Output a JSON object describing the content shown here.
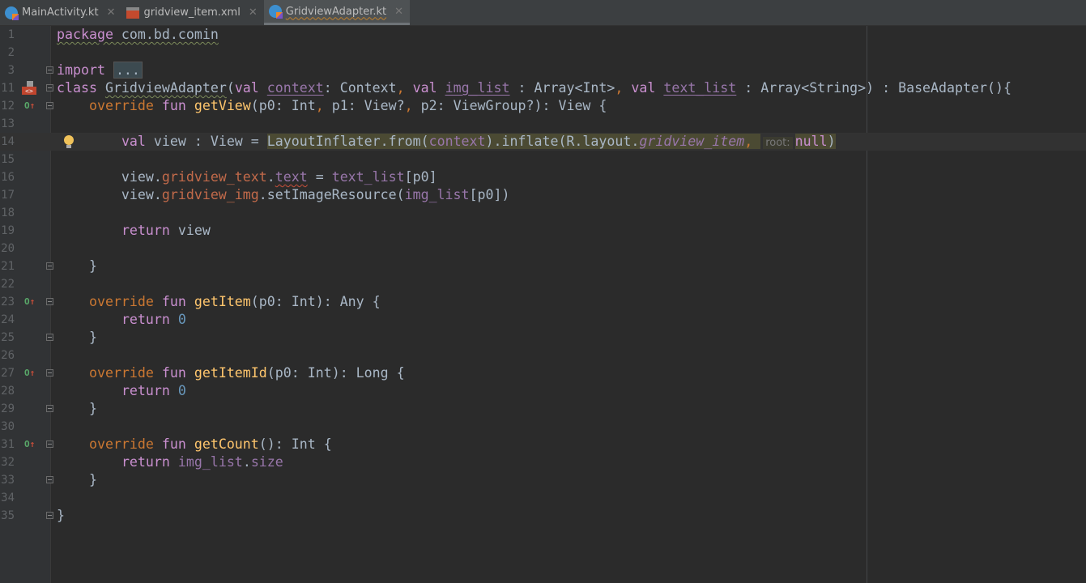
{
  "tabs": [
    {
      "label": "MainActivity.kt",
      "icon": "kotlin-file-icon",
      "active": false
    },
    {
      "label": "gridview_item.xml",
      "icon": "xml-layout-icon",
      "active": false
    },
    {
      "label": "GridviewAdapter.kt",
      "icon": "kotlin-file-icon",
      "active": true
    }
  ],
  "close_glyph": "✕",
  "lines": [
    {
      "num": "1",
      "t": [
        [
          "k wv",
          "package"
        ],
        [
          "t wv",
          " com.bd.comin"
        ]
      ]
    },
    {
      "num": "2",
      "t": []
    },
    {
      "num": "3",
      "fold": true,
      "t": [
        [
          "k",
          "import "
        ],
        [
          "fc o",
          "..."
        ]
      ]
    },
    {
      "num": "11",
      "fold": true,
      "gutter": "xml",
      "t": [
        [
          "k",
          "class "
        ],
        [
          "t wv",
          "GridviewAdapter"
        ],
        [
          "t",
          "("
        ],
        [
          "k",
          "val "
        ],
        [
          "p ul",
          "context"
        ],
        [
          "t",
          ": Context"
        ],
        [
          "o",
          ", "
        ],
        [
          "k",
          "val "
        ],
        [
          "p ul",
          "img_list"
        ],
        [
          "t",
          " : Array<Int>"
        ],
        [
          "o",
          ", "
        ],
        [
          "k",
          "val "
        ],
        [
          "p ul",
          "text_list"
        ],
        [
          "t",
          " : Array<String>) : BaseAdapter(){"
        ]
      ]
    },
    {
      "num": "12",
      "fold": true,
      "gutter": "override",
      "t": [
        [
          "t",
          "    "
        ],
        [
          "o",
          "override "
        ],
        [
          "k",
          "fun "
        ],
        [
          "f",
          "getView"
        ],
        [
          "t",
          "(p0: Int"
        ],
        [
          "o",
          ", "
        ],
        [
          "t",
          "p1: View?"
        ],
        [
          "o",
          ", "
        ],
        [
          "t",
          "p2: ViewGroup?): View {"
        ]
      ]
    },
    {
      "num": "13",
      "t": []
    },
    {
      "num": "14",
      "current": true,
      "bulb": true,
      "t": [
        [
          "t",
          "        "
        ],
        [
          "k",
          "val "
        ],
        [
          "t",
          "view : View = "
        ],
        [
          "t sel",
          "LayoutInflater.from("
        ],
        [
          "p sel",
          "context"
        ],
        [
          "t sel",
          ").inflate(R.layout."
        ],
        [
          "i sel",
          "gridview_item"
        ],
        [
          "o sel",
          ", "
        ],
        [
          "h sel",
          "root:"
        ],
        [
          "k sel",
          "null"
        ],
        [
          "t sel",
          ")"
        ]
      ]
    },
    {
      "num": "15",
      "t": []
    },
    {
      "num": "16",
      "t": [
        [
          "t",
          "        view."
        ],
        [
          "r",
          "gridview_text"
        ],
        [
          "t",
          "."
        ],
        [
          "p wr",
          "text"
        ],
        [
          "t",
          " = "
        ],
        [
          "p",
          "text_list"
        ],
        [
          "t",
          "[p0]"
        ]
      ]
    },
    {
      "num": "17",
      "t": [
        [
          "t",
          "        view."
        ],
        [
          "r",
          "gridview_img"
        ],
        [
          "t",
          ".setImageResource("
        ],
        [
          "p",
          "img_list"
        ],
        [
          "t",
          "[p0])"
        ]
      ]
    },
    {
      "num": "18",
      "t": []
    },
    {
      "num": "19",
      "t": [
        [
          "t",
          "        "
        ],
        [
          "k",
          "return "
        ],
        [
          "t",
          "view"
        ]
      ]
    },
    {
      "num": "20",
      "t": []
    },
    {
      "num": "21",
      "fold": true,
      "t": [
        [
          "t",
          "    }"
        ]
      ]
    },
    {
      "num": "22",
      "t": []
    },
    {
      "num": "23",
      "fold": true,
      "gutter": "override",
      "t": [
        [
          "t",
          "    "
        ],
        [
          "o",
          "override "
        ],
        [
          "k",
          "fun "
        ],
        [
          "f",
          "getItem"
        ],
        [
          "t",
          "(p0: Int): Any {"
        ]
      ]
    },
    {
      "num": "24",
      "t": [
        [
          "t",
          "        "
        ],
        [
          "k",
          "return "
        ],
        [
          "n",
          "0"
        ]
      ]
    },
    {
      "num": "25",
      "fold": true,
      "t": [
        [
          "t",
          "    }"
        ]
      ]
    },
    {
      "num": "26",
      "t": []
    },
    {
      "num": "27",
      "fold": true,
      "gutter": "override",
      "t": [
        [
          "t",
          "    "
        ],
        [
          "o",
          "override "
        ],
        [
          "k",
          "fun "
        ],
        [
          "f",
          "getItemId"
        ],
        [
          "t",
          "(p0: Int): Long {"
        ]
      ]
    },
    {
      "num": "28",
      "t": [
        [
          "t",
          "        "
        ],
        [
          "k",
          "return "
        ],
        [
          "n",
          "0"
        ]
      ]
    },
    {
      "num": "29",
      "fold": true,
      "t": [
        [
          "t",
          "    }"
        ]
      ]
    },
    {
      "num": "30",
      "t": []
    },
    {
      "num": "31",
      "fold": true,
      "gutter": "override",
      "t": [
        [
          "t",
          "    "
        ],
        [
          "o",
          "override "
        ],
        [
          "k",
          "fun "
        ],
        [
          "f",
          "getCount"
        ],
        [
          "t",
          "(): Int {"
        ]
      ]
    },
    {
      "num": "32",
      "t": [
        [
          "t",
          "        "
        ],
        [
          "k",
          "return "
        ],
        [
          "p",
          "img_list"
        ],
        [
          "t",
          "."
        ],
        [
          "p",
          "size"
        ]
      ]
    },
    {
      "num": "33",
      "fold": true,
      "t": [
        [
          "t",
          "    }"
        ]
      ]
    },
    {
      "num": "34",
      "t": []
    },
    {
      "num": "35",
      "fold": true,
      "t": [
        [
          "t",
          "}"
        ]
      ]
    }
  ]
}
